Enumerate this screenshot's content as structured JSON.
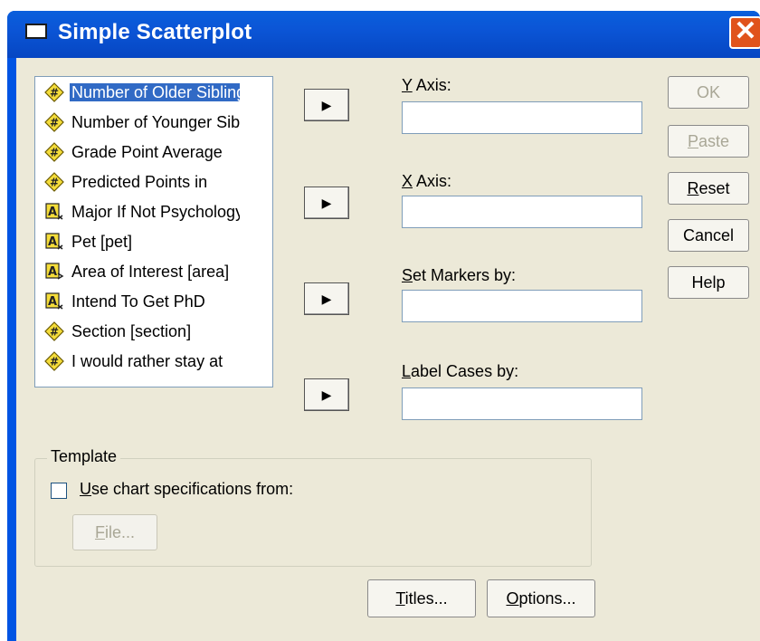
{
  "window": {
    "title": "Simple Scatterplot",
    "close_glyph": "✕"
  },
  "variables": [
    {
      "label": "Number of Older Siblings",
      "icon": "scale-icon",
      "selected": true
    },
    {
      "label": "Number of Younger Siblings",
      "icon": "scale-icon",
      "selected": false
    },
    {
      "label": "Grade Point Average",
      "icon": "scale-icon",
      "selected": false
    },
    {
      "label": "Predicted Points in",
      "icon": "scale-icon",
      "selected": false
    },
    {
      "label": "Major If Not Psychology",
      "icon": "nominal-icon",
      "selected": false
    },
    {
      "label": "Pet [pet]",
      "icon": "nominal-icon",
      "selected": false
    },
    {
      "label": "Area of Interest [area]",
      "icon": "ordinal-icon",
      "selected": false
    },
    {
      "label": "Intend To Get PhD",
      "icon": "nominal-icon",
      "selected": false
    },
    {
      "label": "Section [section]",
      "icon": "scale-icon",
      "selected": false
    },
    {
      "label": "I would rather stay at",
      "icon": "scale-icon",
      "selected": false
    }
  ],
  "fields": {
    "y_axis": {
      "label": "Y Axis:",
      "ul": "Y",
      "rest": " Axis:",
      "value": ""
    },
    "x_axis": {
      "label": "X Axis:",
      "ul": "X",
      "rest": " Axis:",
      "value": ""
    },
    "markers": {
      "label": "Set Markers by:",
      "ul": "S",
      "rest": "et Markers by:",
      "value": ""
    },
    "label_cases": {
      "label": "Label Cases by:",
      "ul": "L",
      "rest": "abel Cases by:",
      "value": ""
    }
  },
  "buttons": {
    "ok": "OK",
    "paste_ul": "P",
    "paste_rest": "aste",
    "reset_ul": "R",
    "reset_rest": "eset",
    "cancel": "Cancel",
    "help": "Help",
    "titles_ul": "T",
    "titles_rest": "itles...",
    "options_ul": "O",
    "options_rest": "ptions...",
    "file_ul": "F",
    "file_rest": "ile..."
  },
  "template": {
    "group_label": "Template",
    "checkbox_ul": "U",
    "checkbox_rest": "se chart specifications from:",
    "checked": false
  },
  "colors": {
    "title_bar": "#0054e3",
    "selection": "#316ac5",
    "dialog_bg": "#ece9d8"
  }
}
